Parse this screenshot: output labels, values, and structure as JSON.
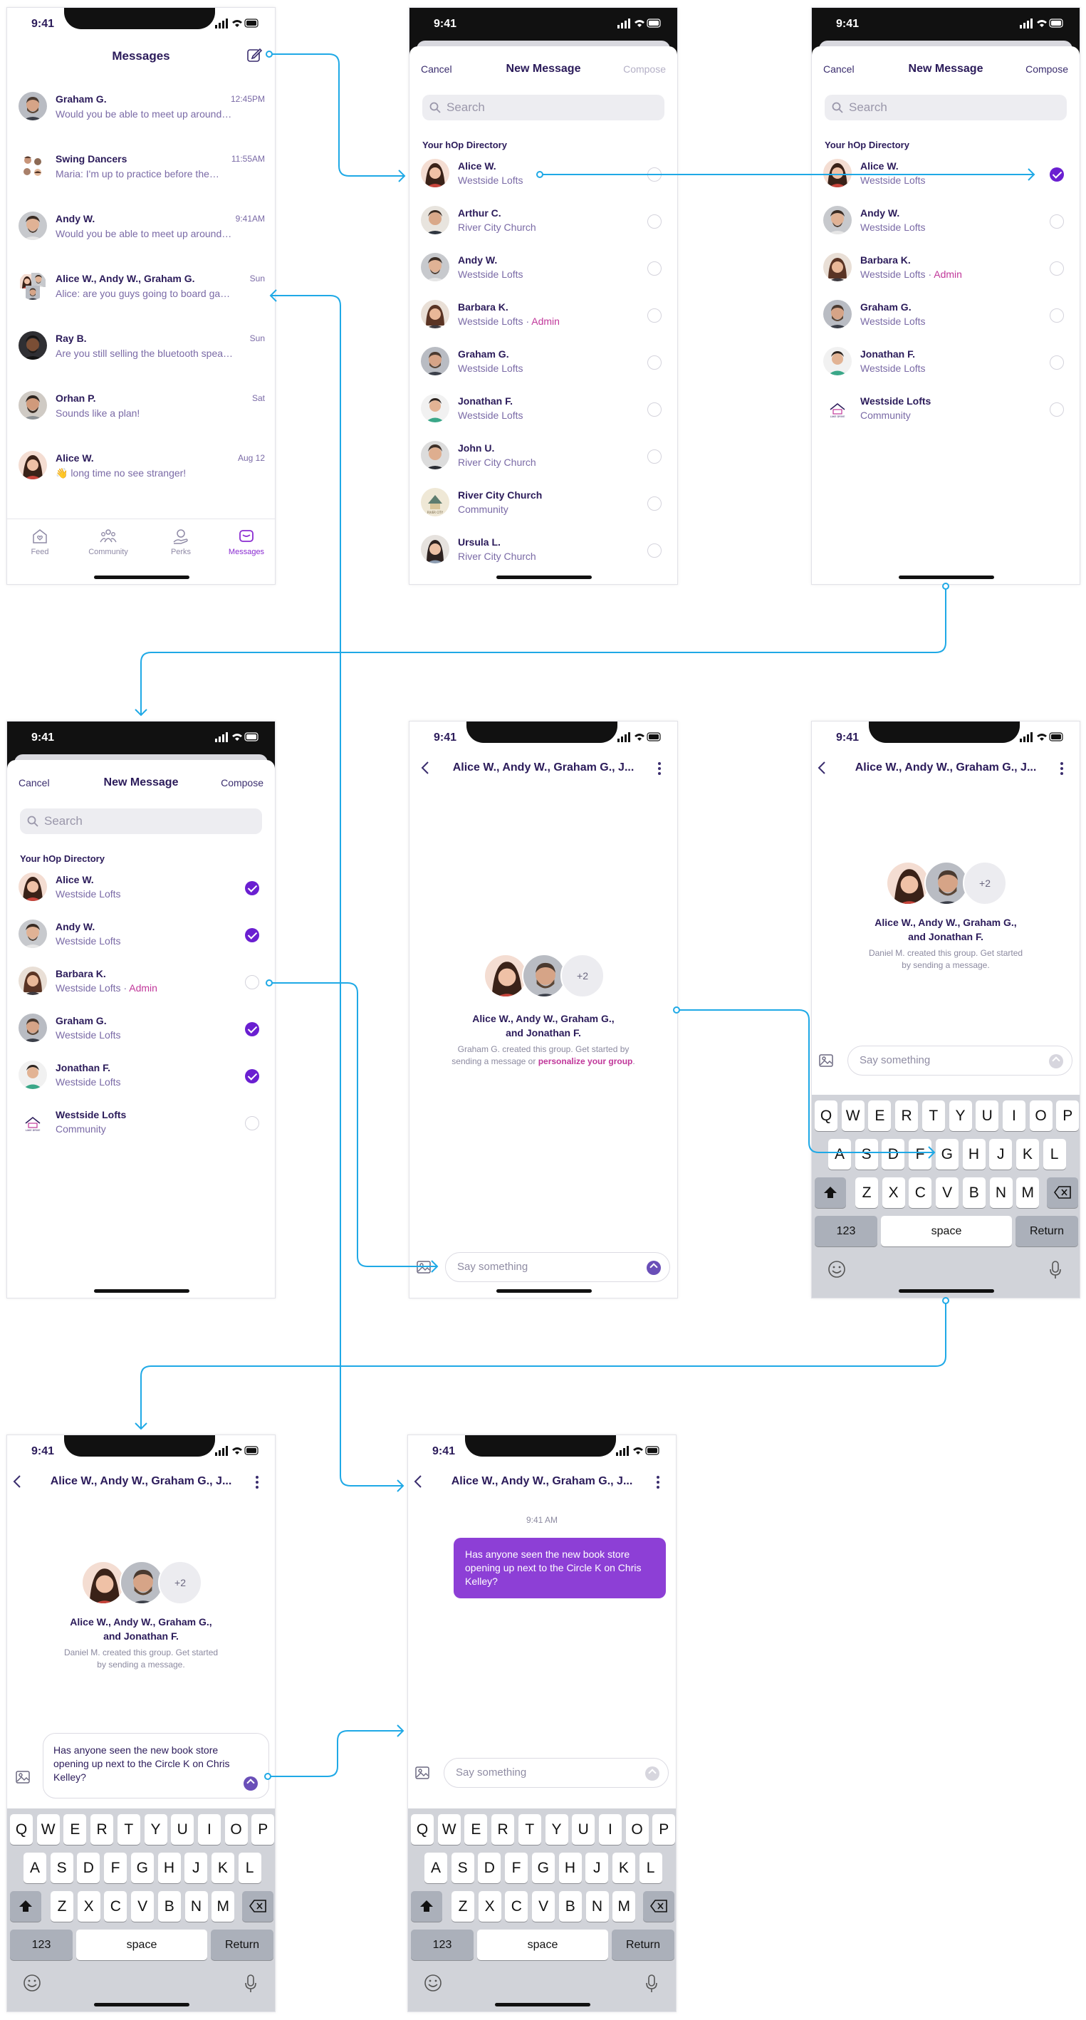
{
  "status": {
    "time": "9:41"
  },
  "messages_screen": {
    "title": "Messages",
    "compose_icon": "compose-icon",
    "conversations": [
      {
        "name": "Graham G.",
        "preview": "Would you be able to meet up around…",
        "time": "12:45PM"
      },
      {
        "name": "Swing Dancers",
        "preview": "Maria: I'm up to practice before the…",
        "time": "11:55AM"
      },
      {
        "name": "Andy W.",
        "preview": "Would you be able to meet up around…",
        "time": "9:41AM"
      },
      {
        "name": "Alice W., Andy W., Graham G.",
        "preview": "Alice: are you guys going to board ga…",
        "time": "Sun"
      },
      {
        "name": "Ray B.",
        "preview": "Are you still selling the bluetooth spea…",
        "time": "Sun"
      },
      {
        "name": "Orhan P.",
        "preview": "Sounds like a plan!",
        "time": "Sat"
      },
      {
        "name": "Alice W.",
        "preview": "👋 long time no see stranger!",
        "time": "Aug 12"
      }
    ],
    "tabs": [
      {
        "label": "Feed",
        "icon": "home-heart-icon"
      },
      {
        "label": "Community",
        "icon": "community-icon"
      },
      {
        "label": "Perks",
        "icon": "perks-icon"
      },
      {
        "label": "Messages",
        "icon": "messages-icon"
      }
    ]
  },
  "new_message": {
    "cancel": "Cancel",
    "title": "New Message",
    "compose": "Compose",
    "search_placeholder": "Search",
    "section": "Your hOp Directory",
    "full_directory": [
      {
        "name": "Alice W.",
        "sub": "Westside Lofts",
        "admin": ""
      },
      {
        "name": "Arthur C.",
        "sub": "River City Church",
        "admin": ""
      },
      {
        "name": "Andy W.",
        "sub": "Westside Lofts",
        "admin": ""
      },
      {
        "name": "Barbara K.",
        "sub": "Westside Lofts · ",
        "admin": "Admin"
      },
      {
        "name": "Graham G.",
        "sub": "Westside Lofts",
        "admin": ""
      },
      {
        "name": "Jonathan F.",
        "sub": "Westside Lofts",
        "admin": ""
      },
      {
        "name": "John U.",
        "sub": "River City Church",
        "admin": ""
      },
      {
        "name": "River City Church",
        "sub": "Community",
        "admin": ""
      },
      {
        "name": "Ursula L.",
        "sub": "River City Church",
        "admin": ""
      }
    ],
    "filtered_directory": [
      {
        "name": "Alice W.",
        "sub": "Westside Lofts",
        "admin": ""
      },
      {
        "name": "Andy W.",
        "sub": "Westside Lofts",
        "admin": ""
      },
      {
        "name": "Barbara K.",
        "sub": "Westside Lofts · ",
        "admin": "Admin"
      },
      {
        "name": "Graham G.",
        "sub": "Westside Lofts",
        "admin": ""
      },
      {
        "name": "Jonathan F.",
        "sub": "Westside Lofts",
        "admin": ""
      },
      {
        "name": "Westside Lofts",
        "sub": "Community",
        "admin": ""
      }
    ],
    "selected_step2": [
      true,
      false,
      false,
      false,
      false,
      false
    ],
    "selected_step3": [
      true,
      true,
      false,
      true,
      true,
      false
    ]
  },
  "group_chat": {
    "title": "Alice W., Andy W., Graham G., J...",
    "plus_count": "+2",
    "members_line1": "Alice W., Andy W., Graham G.,",
    "members_line2": "and Jonathan F.",
    "created_graham_1": "Graham G. created this group. Get started by",
    "created_graham_2": "sending a message or ",
    "personalize_link": "personalize your group",
    "created_daniel_1": "Daniel M. created this group. Get started",
    "created_daniel_2": "by sending a message.",
    "input_placeholder": "Say something",
    "typed_message": "Has anyone seen the new book store opening up next to the Circle K on Chris Kelley?",
    "sent_time": "9:41 AM",
    "sent_message": "Has anyone seen the new book store opening up next to the Circle K on Chris Kelley?"
  },
  "keyboard": {
    "row1": [
      "Q",
      "W",
      "E",
      "R",
      "T",
      "Y",
      "U",
      "I",
      "O",
      "P"
    ],
    "row2": [
      "A",
      "S",
      "D",
      "F",
      "G",
      "H",
      "J",
      "K",
      "L"
    ],
    "row3": [
      "Z",
      "X",
      "C",
      "V",
      "B",
      "N",
      "M"
    ],
    "numbers": "123",
    "space": "space",
    "return": "Return"
  },
  "colors": {
    "accent": "#6a1fd1",
    "bubble": "#8d3fd6",
    "admin": "#c0379a",
    "flow_line": "#1fa9e6",
    "text_dark": "#2b1b5a",
    "text_sub": "#7a6aa6"
  }
}
